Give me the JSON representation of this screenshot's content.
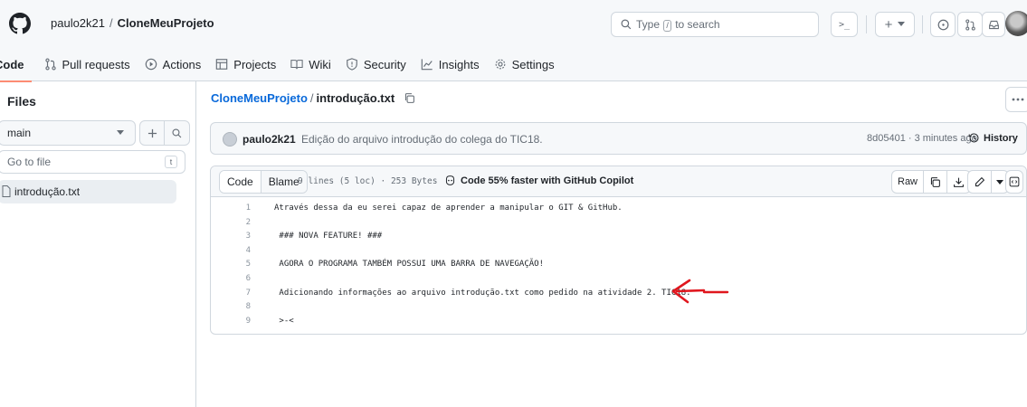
{
  "header": {
    "owner": "paulo2k21",
    "separator": "/",
    "repo": "CloneMeuProjeto",
    "search": {
      "before": "Type",
      "key": "/",
      "after": "to search"
    },
    "command_label": ">_",
    "plus_label": "+"
  },
  "tabs": [
    {
      "label": "Code",
      "icon": "code-icon",
      "active": true
    },
    {
      "label": "Pull requests",
      "icon": "pull-request-icon"
    },
    {
      "label": "Actions",
      "icon": "play-icon"
    },
    {
      "label": "Projects",
      "icon": "table-icon"
    },
    {
      "label": "Wiki",
      "icon": "book-icon"
    },
    {
      "label": "Security",
      "icon": "shield-icon"
    },
    {
      "label": "Insights",
      "icon": "graph-icon"
    },
    {
      "label": "Settings",
      "icon": "gear-icon"
    }
  ],
  "sidebar": {
    "title": "Files",
    "branch": "main",
    "goto_placeholder": "Go to file",
    "goto_key": "t",
    "tree": [
      {
        "label": "introdução.txt",
        "selected": true
      }
    ]
  },
  "breadcrumb": {
    "repo": "CloneMeuProjeto",
    "separator": "/",
    "file": "introdução.txt"
  },
  "commit": {
    "author": "paulo2k21",
    "message": "Edição do arquivo introdução do colega do TIC18.",
    "meta": "8d05401 · 3 minutes ago",
    "history_label": "History"
  },
  "file": {
    "tabs": {
      "code": "Code",
      "blame": "Blame"
    },
    "stats": "9 lines (5 loc) · 253 Bytes",
    "copilot": "Code 55% faster with GitHub Copilot",
    "raw_label": "Raw",
    "lines": [
      {
        "n": "1",
        "text": "Através dessa da eu serei capaz de aprender a manipular o GIT & GitHub."
      },
      {
        "n": "2",
        "text": ""
      },
      {
        "n": "3",
        "text": " ### NOVA FEATURE! ###"
      },
      {
        "n": "4",
        "text": ""
      },
      {
        "n": "5",
        "text": " AGORA O PROGRAMA TAMBÉM POSSUI UMA BARRA DE NAVEGAÇÃO!"
      },
      {
        "n": "6",
        "text": ""
      },
      {
        "n": "7",
        "text": " Adicionando informações ao arquivo introdução.txt como pedido na atividade 2. TIC18."
      },
      {
        "n": "8",
        "text": ""
      },
      {
        "n": "9",
        "text": " >-<"
      }
    ]
  },
  "colors": {
    "link": "#0969da",
    "active_tab_underline": "#fd8c73",
    "annotation_arrow": "#e0171e"
  }
}
